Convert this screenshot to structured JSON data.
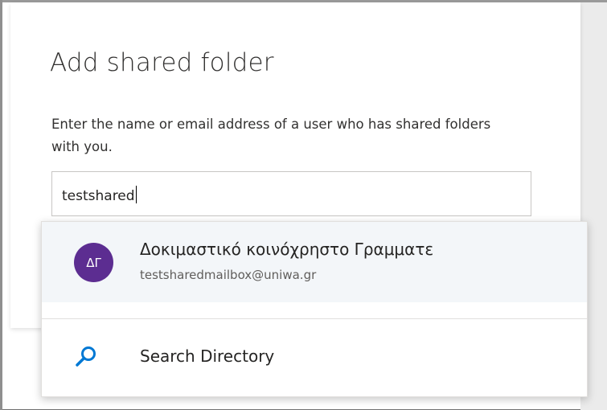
{
  "dialog": {
    "title": "Add shared folder",
    "description": "Enter the name or email address of a user who has shared folders with you.",
    "input": {
      "value": "testshared",
      "placeholder": ""
    }
  },
  "suggestions": [
    {
      "initials": "ΔΓ",
      "name": "Δοκιμαστικό κοινόχρηστο Γραμματε",
      "email": "testsharedmailbox@uniwa.gr",
      "avatar_color": "#5c2d91"
    }
  ],
  "search_directory": {
    "label": "Search Directory",
    "icon": "search-icon",
    "icon_color": "#0078d4"
  }
}
